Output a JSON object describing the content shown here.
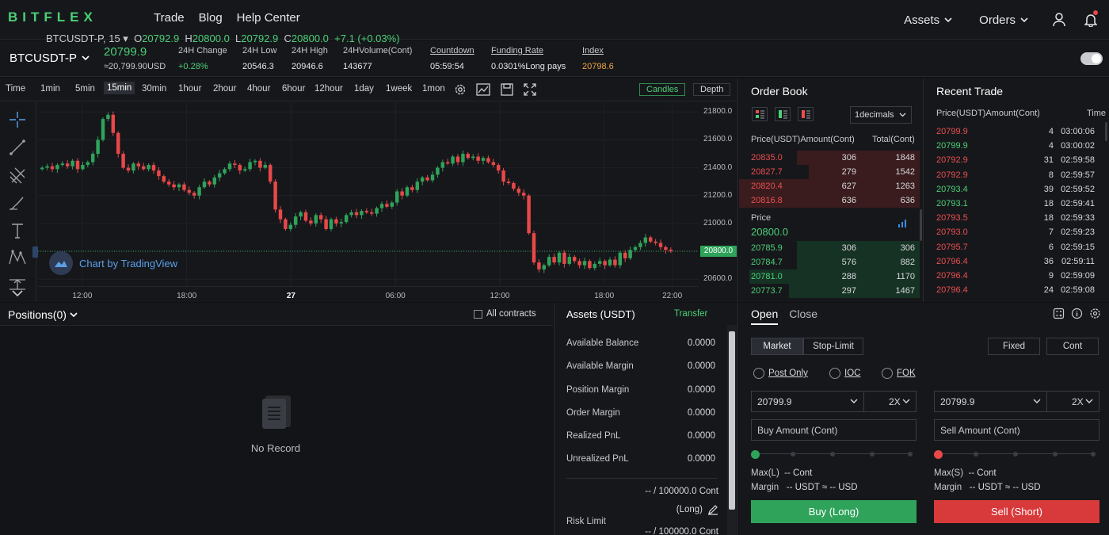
{
  "brand": {
    "logo": "BITFLEX",
    "accent": "#4bd077",
    "sell_color": "#ea4f4f"
  },
  "nav": {
    "links": [
      "Trade",
      "Blog",
      "Help Center"
    ],
    "assets_label": "Assets",
    "orders_label": "Orders",
    "icons": [
      "user-icon",
      "bell-icon"
    ]
  },
  "ticker": {
    "symbol": "BTCUSDT-P",
    "last_price": "20799.9",
    "last_price_usd": "≈20,799.90USD",
    "stats": [
      {
        "label": "24H Change",
        "value": "+0.28%"
      },
      {
        "label": "24H Low",
        "value": "20546.3"
      },
      {
        "label": "24H High",
        "value": "20946.6"
      },
      {
        "label": "24HVolume(Cont)",
        "value": "143677"
      },
      {
        "label": "Countdown",
        "value": "05:59:54"
      },
      {
        "label": "Funding Rate",
        "value": "0.0301%Long pays"
      },
      {
        "label": "Index",
        "value": "20798.6"
      }
    ]
  },
  "timeframes": [
    "Time",
    "1min",
    "5min",
    "15min",
    "30min",
    "1hour",
    "2hour",
    "4hour",
    "6hour",
    "12hour",
    "1day",
    "1week",
    "1mon"
  ],
  "timeframe_active": "15min",
  "chart_buttons": {
    "candles": "Candles",
    "depth": "Depth"
  },
  "chart_header": {
    "symbol": "BTCUSDT-P, 15",
    "o_label": "O",
    "o": "20792.9",
    "h_label": "H",
    "h": "20800.0",
    "l_label": "L",
    "l": "20792.9",
    "c_label": "C",
    "c": "20800.0",
    "change": "+7.1 (+0.03%)"
  },
  "tv_logo": "Chart by TradingView",
  "chart_data": {
    "type": "candlestick",
    "yticks": [
      "21800.0",
      "21600.0",
      "21400.0",
      "21200.0",
      "21000.0",
      "20800.0",
      "20600.0"
    ],
    "ylim": [
      20550,
      21870
    ],
    "xticks": [
      "12:00",
      "18:00",
      "27",
      "06:00",
      "12:00",
      "18:00",
      "22:00"
    ],
    "current_price_label": "20800.0",
    "current_price": 20800,
    "closes": [
      21400,
      21410,
      21390,
      21420,
      21430,
      21410,
      21450,
      21390,
      21420,
      21440,
      21500,
      21600,
      21750,
      21780,
      21650,
      21500,
      21400,
      21380,
      21430,
      21410,
      21390,
      21420,
      21380,
      21340,
      21300,
      21280,
      21260,
      21280,
      21240,
      21220,
      21200,
      21260,
      21300,
      21280,
      21330,
      21360,
      21390,
      21430,
      21420,
      21380,
      21390,
      21440,
      21450,
      21400,
      21420,
      21300,
      21100,
      21030,
      20960,
      20990,
      21050,
      21080,
      21020,
      21000,
      21060,
      21030,
      20960,
      21030,
      21000,
      21010,
      21060,
      21080,
      21060,
      21090,
      21080,
      21070,
      21110,
      21140,
      21120,
      21150,
      21230,
      21200,
      21260,
      21240,
      21300,
      21330,
      21310,
      21350,
      21400,
      21440,
      21430,
      21480,
      21440,
      21500,
      21470,
      21480,
      21450,
      21470,
      21440,
      21420,
      21380,
      21300,
      21290,
      21250,
      21220,
      21200,
      20930,
      20720,
      20670,
      20700,
      20760,
      20720,
      20790,
      20710,
      20760,
      20730,
      20700,
      20730,
      20680,
      20710,
      20730,
      20700,
      20740,
      20700,
      20790,
      20750,
      20810,
      20830,
      20860,
      20900,
      20870,
      20860,
      20830,
      20810,
      20800
    ]
  },
  "orderbook": {
    "title": "Order Book",
    "decimals": "1decimals",
    "headers": {
      "price": "Price(USDT)",
      "amount": "Amount(Cont)",
      "total": "Total(Cont)"
    },
    "asks": [
      {
        "price": "20835.0",
        "amount": "306",
        "total": "1848",
        "depth": 0.77
      },
      {
        "price": "20827.7",
        "amount": "279",
        "total": "1542",
        "depth": 0.7
      },
      {
        "price": "20820.4",
        "amount": "627",
        "total": "1263",
        "depth": 0.99
      },
      {
        "price": "20816.8",
        "amount": "636",
        "total": "636",
        "depth": 0.99
      }
    ],
    "mid_label": "Price",
    "mid_price": "20800.0",
    "bids": [
      {
        "price": "20785.9",
        "amount": "306",
        "total": "306",
        "depth": 0.7
      },
      {
        "price": "20784.7",
        "amount": "576",
        "total": "882",
        "depth": 0.7
      },
      {
        "price": "20781.0",
        "amount": "288",
        "total": "1170",
        "depth": 0.95
      },
      {
        "price": "20773.7",
        "amount": "297",
        "total": "1467",
        "depth": 0.75
      }
    ]
  },
  "recent_trades": {
    "title": "Recent Trade",
    "headers": {
      "price": "Price(USDT)",
      "amount": "Amount(Cont)",
      "time": "Time"
    },
    "rows": [
      {
        "price": "20799.9",
        "amount": "4",
        "time": "03:00:06",
        "side": "sell"
      },
      {
        "price": "20799.9",
        "amount": "4",
        "time": "03:00:02",
        "side": "buy"
      },
      {
        "price": "20792.9",
        "amount": "31",
        "time": "02:59:58",
        "side": "sell"
      },
      {
        "price": "20792.9",
        "amount": "8",
        "time": "02:59:57",
        "side": "sell"
      },
      {
        "price": "20793.4",
        "amount": "39",
        "time": "02:59:52",
        "side": "buy"
      },
      {
        "price": "20793.1",
        "amount": "18",
        "time": "02:59:41",
        "side": "buy"
      },
      {
        "price": "20793.5",
        "amount": "18",
        "time": "02:59:33",
        "side": "sell"
      },
      {
        "price": "20793.0",
        "amount": "7",
        "time": "02:59:23",
        "side": "sell"
      },
      {
        "price": "20795.7",
        "amount": "6",
        "time": "02:59:15",
        "side": "sell"
      },
      {
        "price": "20796.4",
        "amount": "36",
        "time": "02:59:11",
        "side": "sell"
      },
      {
        "price": "20796.4",
        "amount": "9",
        "time": "02:59:09",
        "side": "sell"
      },
      {
        "price": "20796.4",
        "amount": "24",
        "time": "02:59:08",
        "side": "sell"
      }
    ]
  },
  "positions": {
    "title": "Positions(0)",
    "all_contracts": "All contracts",
    "empty": "No Record"
  },
  "assets": {
    "title": "Assets (USDT)",
    "transfer": "Transfer",
    "rows": [
      {
        "label": "Available Balance",
        "value": "0.0000"
      },
      {
        "label": "Available Margin",
        "value": "0.0000"
      },
      {
        "label": "Position Margin",
        "value": "0.0000"
      },
      {
        "label": "Order Margin",
        "value": "0.0000"
      },
      {
        "label": "Realized PnL",
        "value": "0.0000"
      },
      {
        "label": "Unrealized PnL",
        "value": "0.0000"
      }
    ],
    "risk_line1": "-- / 100000.0 Cont",
    "risk_line2": "(Long)",
    "risk_label": "Risk Limit",
    "risk_line3": "-- / 100000.0 Cont"
  },
  "order_form": {
    "tabs": [
      "Open",
      "Close"
    ],
    "types": [
      "Market",
      "Stop-Limit"
    ],
    "units": [
      "Fixed",
      "Cont"
    ],
    "tif": [
      "Post Only",
      "IOC",
      "FOK"
    ],
    "buy": {
      "price": "20799.9",
      "leverage": "2X",
      "amount_placeholder": "Buy Amount (Cont)",
      "max_label": "Max(L)",
      "max_value": "-- Cont",
      "margin_label": "Margin",
      "margin_value": "-- USDT ≈ -- USD",
      "button": "Buy (Long)"
    },
    "sell": {
      "price": "20799.9",
      "leverage": "2X",
      "amount_placeholder": "Sell  Amount (Cont)",
      "max_label": "Max(S)",
      "max_value": "-- Cont",
      "margin_label": "Margin",
      "margin_value": "-- USDT ≈ -- USD",
      "button": "Sell (Short)"
    }
  }
}
